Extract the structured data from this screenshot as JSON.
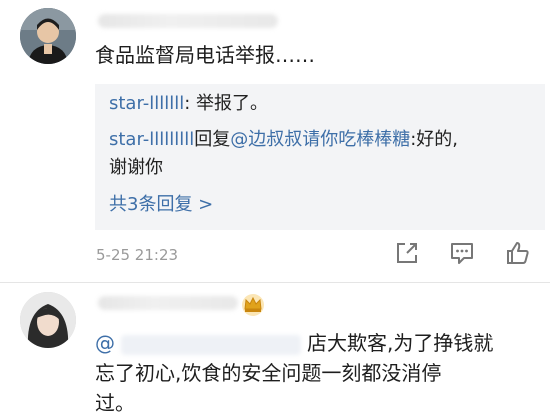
{
  "comment1": {
    "text": "食品监督局电话举报……",
    "replies": [
      {
        "user": "star-lllllll",
        "sep": ": ",
        "text": "举报了。"
      },
      {
        "user": "star-lllllllll",
        "verb": "回复",
        "mention": "@边叔叔请你吃棒棒糖",
        "text": ":好的,",
        "text2": "谢谢你"
      }
    ],
    "more_replies": "共3条回复 >",
    "timestamp": "5-25 21:23",
    "icons": [
      "share-icon",
      "comment-icon",
      "like-icon"
    ]
  },
  "comment2": {
    "mention_prefix": "@",
    "line1_rest": "店大欺客,为了挣钱就",
    "line2": "忘了初心,饮食的安全问题一刻都没消停",
    "line3": "过。"
  },
  "colors": {
    "link": "#3e6fa8",
    "reply_bg": "#f3f4f6",
    "time": "#9a9a9a",
    "crown": "#e0a21b"
  }
}
